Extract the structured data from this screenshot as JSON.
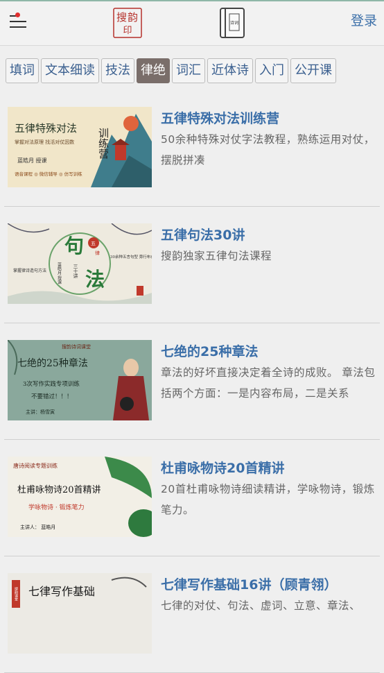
{
  "header": {
    "logo_text": "搜韵",
    "book_icon_text": "诗词",
    "login_label": "登录"
  },
  "tabs": [
    {
      "label": "填词",
      "active": false
    },
    {
      "label": "文本细读",
      "active": false
    },
    {
      "label": "技法",
      "active": false
    },
    {
      "label": "律绝",
      "active": true
    },
    {
      "label": "词汇",
      "active": false
    },
    {
      "label": "近体诗",
      "active": false
    },
    {
      "label": "入门",
      "active": false
    },
    {
      "label": "公开课",
      "active": false
    }
  ],
  "courses": [
    {
      "title": "五律特殊对法训练营",
      "desc": "50余种特殊对仗字法教程，熟练运用对仗，摆脱拼凑",
      "thumb": {
        "heading": "五律特殊对法",
        "side": "训练营",
        "line1": "掌握对法原理  找活对仗因数",
        "teacher": "蓝皓月  授课",
        "tags": "语音课程 ◎ 微信辅导 ◎ 仿写训练"
      }
    },
    {
      "title": "五律句法30讲",
      "desc": "搜韵独家五律句法课程",
      "thumb": {
        "big1": "句",
        "big2": "法",
        "badge1": "五",
        "badge2": "律",
        "sub": "三十讲",
        "teacher": "蓝皓月 授课",
        "left_note": "掌握律诗造句方法",
        "right_note": "30余种五言句型 旁行布衣"
      }
    },
    {
      "title": "七绝的25种章法",
      "desc": "章法的好坏直接决定着全诗的成败。 章法包括两个方面：一是内容布局，二是关系",
      "thumb": {
        "brand": "搜韵诗词课堂",
        "heading": "七绝的25种章法",
        "line1": "3次写作实践专项训练",
        "line2": "不要错过！！！",
        "teacher": "主讲：杨雪寅"
      }
    },
    {
      "title": "杜甫咏物诗20首精讲",
      "desc": "20首杜甫咏物诗细读精讲，学咏物诗，锻炼笔力。",
      "thumb": {
        "top": "唐诗阅读专题训练",
        "heading": "杜甫咏物诗20首精讲",
        "line1": "学咏物诗 · 锻炼笔力",
        "teacher": "主讲人：  蓝皓月"
      }
    },
    {
      "title": "七律写作基础16讲（顾青翎）",
      "desc": "七律的对仗、句法、虚词、立意、章法、",
      "thumb": {
        "stamp": "搜韵课堂",
        "heading": "七律写作基础"
      }
    }
  ],
  "colors": {
    "accent": "#3a6ea8",
    "active_tab": "#7a6e6a",
    "seal_red": "#b5302a"
  }
}
